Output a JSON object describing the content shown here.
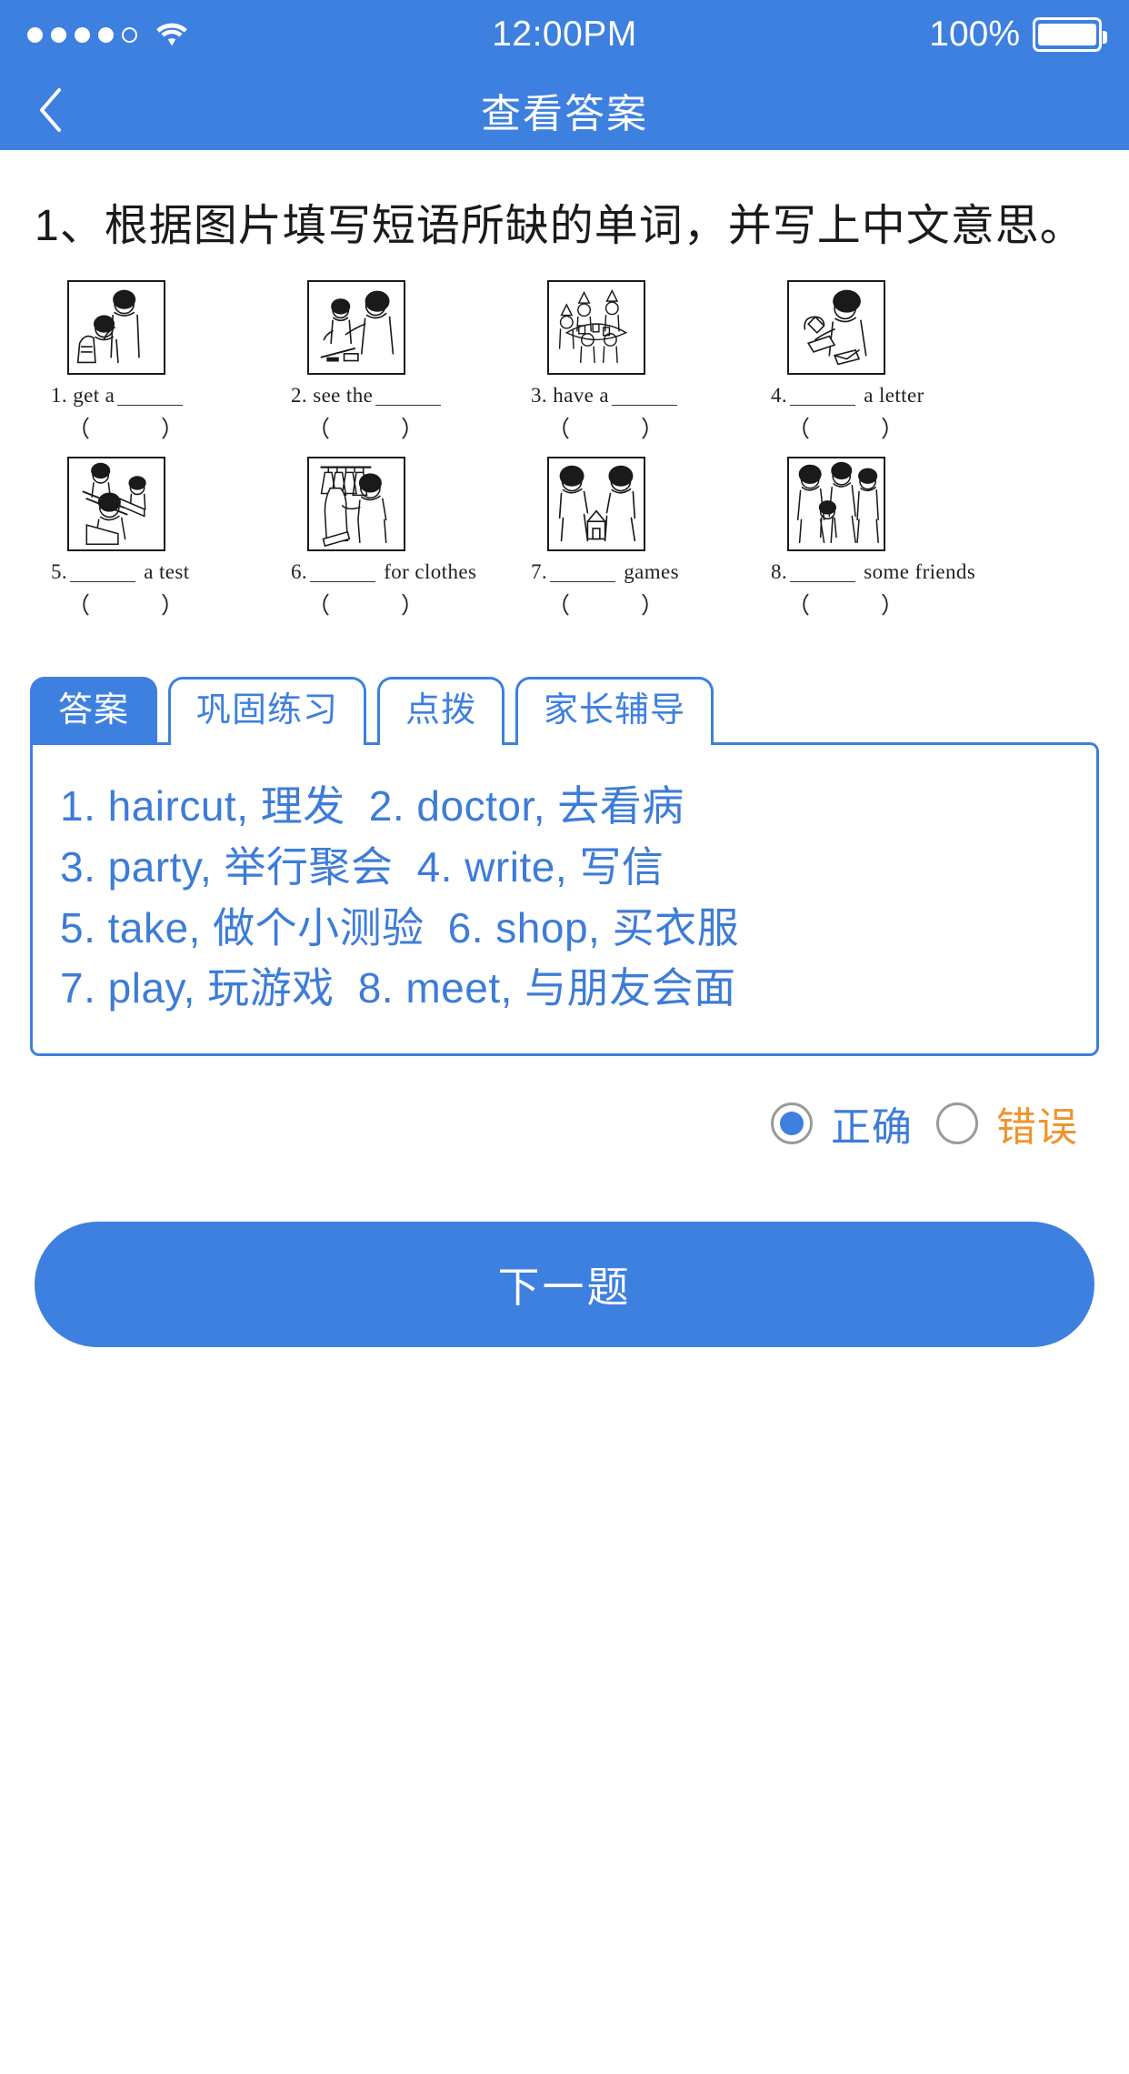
{
  "statusbar": {
    "signal_icon": "signal-dots-icon",
    "wifi_icon": "wifi-icon",
    "time": "12:00PM",
    "battery_percent": "100%",
    "battery_icon": "battery-full-icon"
  },
  "navbar": {
    "back_icon": "chevron-left-icon",
    "title": "查看答案"
  },
  "question": {
    "text": "1、根据图片填写短语所缺的单词，并写上中文意思。"
  },
  "exercise": {
    "items": [
      {
        "num": "1.",
        "pre": "get a",
        "post": "",
        "image": "haircut-illustration",
        "paren_left": "（",
        "paren_right": "）"
      },
      {
        "num": "2.",
        "pre": "see the",
        "post": "",
        "image": "doctor-illustration",
        "paren_left": "（",
        "paren_right": "）"
      },
      {
        "num": "3.",
        "pre": "have a",
        "post": "",
        "image": "party-illustration",
        "paren_left": "（",
        "paren_right": "）"
      },
      {
        "num": "4.",
        "pre": "",
        "post": "a letter",
        "image": "write-letter-illustration",
        "paren_left": "（",
        "paren_right": "）"
      },
      {
        "num": "5.",
        "pre": "",
        "post": "a test",
        "image": "take-test-illustration",
        "paren_left": "（",
        "paren_right": "）"
      },
      {
        "num": "6.",
        "pre": "",
        "post": "for clothes",
        "image": "shop-clothes-illustration",
        "paren_left": "（",
        "paren_right": "）"
      },
      {
        "num": "7.",
        "pre": "",
        "post": "games",
        "image": "play-games-illustration",
        "paren_left": "（",
        "paren_right": "）"
      },
      {
        "num": "8.",
        "pre": "",
        "post": "some friends",
        "image": "meet-friends-illustration",
        "paren_left": "（",
        "paren_right": "）"
      }
    ]
  },
  "tabs": [
    {
      "label": "答案",
      "active": true
    },
    {
      "label": "巩固练习",
      "active": false
    },
    {
      "label": "点拨",
      "active": false
    },
    {
      "label": "家长辅导",
      "active": false
    }
  ],
  "answer": {
    "lines": [
      {
        "a": "1. haircut, 理发",
        "b": "2. doctor, 去看病"
      },
      {
        "a": "3. party, 举行聚会",
        "b": "4. write, 写信"
      },
      {
        "a": "5. take, 做个小测验",
        "b": "6. shop, 买衣服"
      },
      {
        "a": "7. play, 玩游戏",
        "b": "8. meet, 与朋友会面"
      }
    ]
  },
  "judgement": {
    "correct_label": "正确",
    "wrong_label": "错误",
    "selected": "correct"
  },
  "footer": {
    "next_label": "下一题"
  },
  "colors": {
    "brand_blue": "#3D80DF",
    "answer_blue": "#3D7CD8",
    "warn_orange": "#F0942E",
    "radio_gray": "#9a9a9a"
  }
}
